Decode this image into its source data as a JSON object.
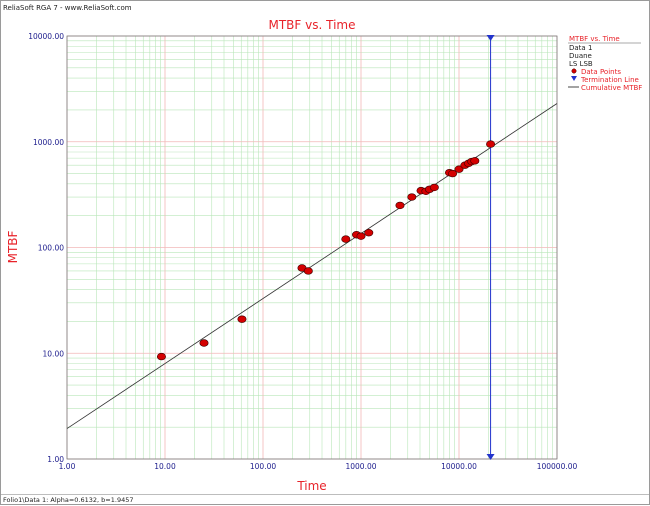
{
  "window": {
    "title": "ReliaSoft RGA 7 - www.ReliaSoft.com"
  },
  "status_bar": {
    "text": "Folio1\\Data 1: Alpha=0.6132, b=1.9457"
  },
  "colors": {
    "title": "#e8232a",
    "axis_label": "#e8232a",
    "tick_label": "#1c1c8c",
    "major_grid": "#f2b8b8",
    "minor_grid": "#b9e6b9",
    "points": "#d40000",
    "termination": "#2233cc",
    "fit_line": "#333333"
  },
  "chart_data": {
    "type": "scatter",
    "title": "MTBF vs. Time",
    "xlabel": "Time",
    "ylabel": "MTBF",
    "x_scale": "log",
    "y_scale": "log",
    "xlim": [
      1,
      100000
    ],
    "ylim": [
      1,
      10000
    ],
    "x_tick_labels": [
      "1.00",
      "10.00",
      "100.00",
      "1000.00",
      "10000.00",
      "100000.00"
    ],
    "y_tick_labels": [
      "1.00",
      "10.00",
      "100.00",
      "1000.00",
      "10000.00"
    ],
    "grid": true,
    "legend_position": "right",
    "legend": {
      "header": "MTBF vs. Time",
      "info_lines": [
        "Data 1",
        "Duane",
        "LS LSB"
      ],
      "entries": [
        {
          "label": "Data Points",
          "marker": "dot"
        },
        {
          "label": "Termination Line",
          "marker": "triangle-down"
        },
        {
          "label": "Cumulative MTBF",
          "marker": "line"
        }
      ]
    },
    "series": [
      {
        "name": "Data Points",
        "x": [
          9.2,
          25,
          61,
          250,
          290,
          700,
          900,
          1000,
          1200,
          2500,
          3300,
          4100,
          4600,
          5000,
          5600,
          8000,
          8600,
          10000,
          11500,
          12500,
          13500,
          14500,
          21000
        ],
        "y": [
          9.3,
          12.5,
          21,
          64,
          60,
          120,
          132,
          128,
          138,
          250,
          300,
          345,
          340,
          355,
          370,
          510,
          500,
          550,
          600,
          625,
          650,
          660,
          950
        ]
      }
    ],
    "fit_line": {
      "name": "Cumulative MTBF",
      "x": [
        1,
        100000
      ],
      "y": [
        1.94,
        2300
      ]
    },
    "termination_line": {
      "name": "Termination Line",
      "x": 21000
    }
  }
}
